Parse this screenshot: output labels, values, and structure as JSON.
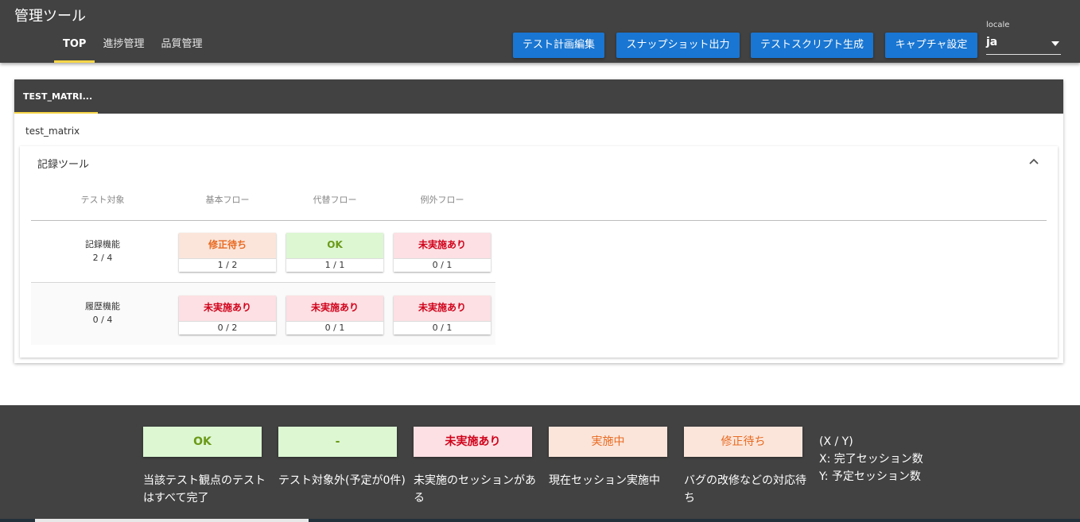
{
  "app": {
    "title": "管理ツール"
  },
  "nav": {
    "tabs": [
      {
        "label": "TOP"
      },
      {
        "label": "進捗管理"
      },
      {
        "label": "品質管理"
      }
    ]
  },
  "toolbar": {
    "buttons": [
      {
        "label": "テスト計画編集"
      },
      {
        "label": "スナップショット出力"
      },
      {
        "label": "テストスクリプト生成"
      },
      {
        "label": "キャプチャ設定"
      }
    ]
  },
  "locale": {
    "label": "locale",
    "value": "ja"
  },
  "card": {
    "tab_label": "TEST_MATRI...",
    "matrix_name": "test_matrix"
  },
  "panel": {
    "title": "記録ツール",
    "columns": [
      "テスト対象",
      "基本フロー",
      "代替フロー",
      "例外フロー"
    ],
    "rows": [
      {
        "name": "記録機能",
        "progress": "2 / 4",
        "cells": [
          {
            "status": "修正待ち",
            "count": "1 / 2"
          },
          {
            "status": "OK",
            "count": "1 / 1"
          },
          {
            "status": "未実施あり",
            "count": "0 / 1"
          }
        ]
      },
      {
        "name": "履歴機能",
        "progress": "0 / 4",
        "cells": [
          {
            "status": "未実施あり",
            "count": "0 / 2"
          },
          {
            "status": "未実施あり",
            "count": "0 / 1"
          },
          {
            "status": "未実施あり",
            "count": "0 / 1"
          }
        ]
      }
    ]
  },
  "legend": {
    "items": [
      {
        "label": "OK",
        "desc": "当該テスト観点のテストはすべて完了"
      },
      {
        "label": "-",
        "desc": "テスト対象外(予定が0件)"
      },
      {
        "label": "未実施あり",
        "desc": "未実施のセッションがある"
      },
      {
        "label": "実施中",
        "desc": "現在セッション実施中"
      },
      {
        "label": "修正待ち",
        "desc": "バグの改修などの対応待ち"
      }
    ],
    "xy": {
      "title": "(X / Y)",
      "x": "X: 完了セッション数",
      "y": "Y: 予定セッション数"
    }
  },
  "colors": {
    "header_bg": "#424242",
    "button_blue": "#1976d2",
    "tab_indicator": "#f5d547",
    "ok_bg": "#dcf7d2",
    "ok_text": "#6b9a18",
    "ng_bg": "#fce0e3",
    "ng_text": "#d0021b",
    "fix_bg": "#fbe5da",
    "fix_text": "#e86a21",
    "doing_bg": "#fbe5da",
    "doing_text": "#e86a21"
  },
  "icons": {
    "panel_toggle": "chevron-up-icon",
    "locale_dropdown": "caret-down-icon"
  }
}
